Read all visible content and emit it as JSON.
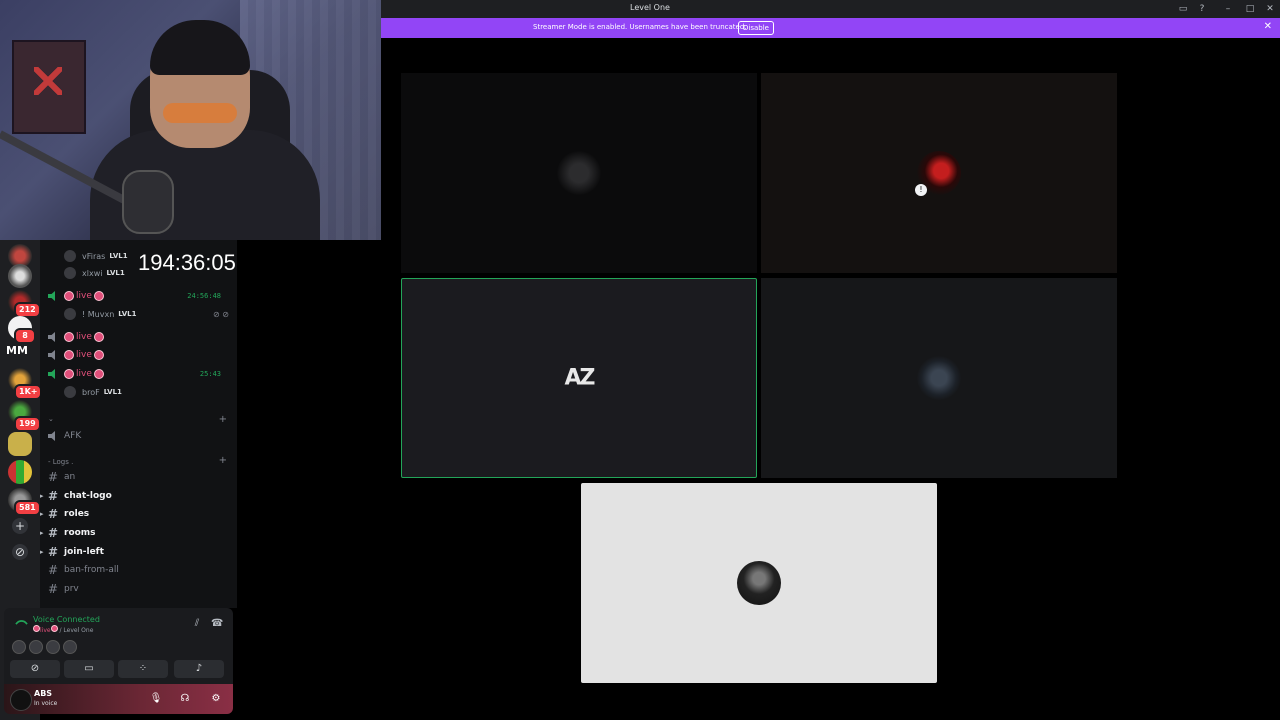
{
  "clock": "194:36:05",
  "window": {
    "title": "Level One"
  },
  "banner": {
    "message": "Streamer Mode is enabled. Usernames have been truncated.",
    "disable_label": "Disable"
  },
  "servers": {
    "mm_label": "MM",
    "badges": [
      "212",
      "8",
      "1K+",
      "199",
      "581"
    ]
  },
  "voice_members_top": [
    {
      "name": "vFiras",
      "level": "LVL1"
    },
    {
      "name": "xlxwi",
      "level": "LVL1"
    }
  ],
  "voice_channels": [
    {
      "label": "live",
      "timer": "24:56:48",
      "member": {
        "name": "! Muvxn",
        "level": "LVL1"
      }
    },
    {
      "label": "live"
    },
    {
      "label": "live"
    },
    {
      "label": "live",
      "timer": "25:43",
      "member": {
        "name": "broF",
        "level": "LVL1"
      }
    }
  ],
  "afk_channel": "AFK",
  "logs_category": "- Logs .",
  "text_channels": [
    {
      "name": "an",
      "bold": false
    },
    {
      "name": "chat-logo",
      "bold": true
    },
    {
      "name": "roles",
      "bold": true
    },
    {
      "name": "rooms",
      "bold": true
    },
    {
      "name": "join-left",
      "bold": true
    },
    {
      "name": "ban-from-all",
      "bold": false
    },
    {
      "name": "prv",
      "bold": false
    }
  ],
  "voice_panel": {
    "status": "Voice Connected",
    "channel_live": "live",
    "channel_path": "/ Level One"
  },
  "user_panel": {
    "name": "ABS",
    "status": "In voice"
  },
  "tiles": {
    "logo_text": "AZ"
  },
  "colors": {
    "accent": "#9245f6",
    "connected": "#23a559",
    "speaking_border": "#23a559",
    "live": "#e04f7a"
  }
}
